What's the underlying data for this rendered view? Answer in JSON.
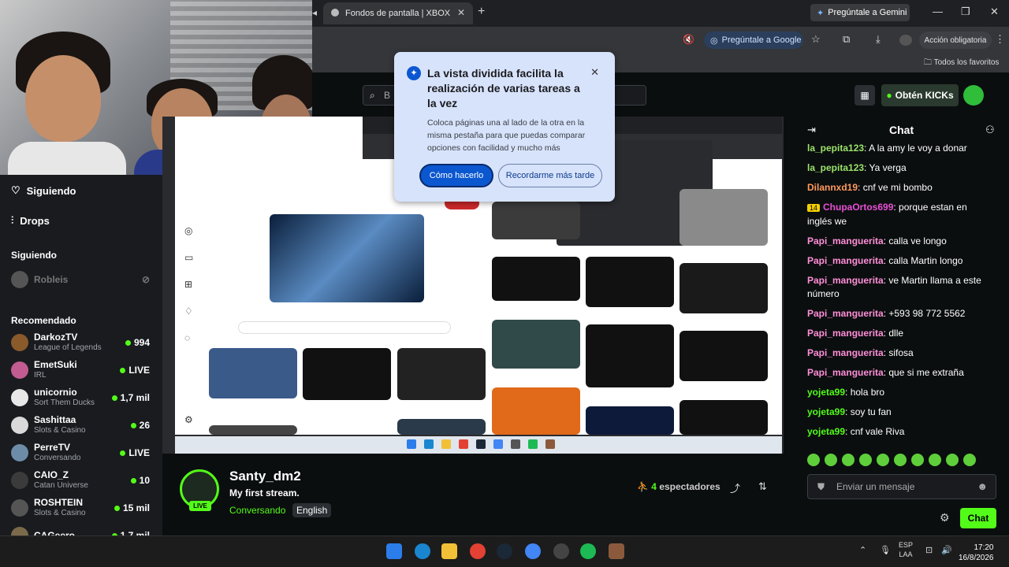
{
  "browser": {
    "tab_title": "Fondos de pantalla | XBOX",
    "gemini_button": "Pregúntale a Gemini",
    "ask_google": "Pregúntale a Google",
    "action_required": "Acción obligatoria",
    "favorites": "Todos los favoritos"
  },
  "kick": {
    "search_placeholder": "B",
    "kicks_button": "Obtén KICKs"
  },
  "popup": {
    "title": "La vista dividida facilita la realización de varias tareas a la vez",
    "body": "Coloca páginas una al lado de la otra en la misma pestaña para que puedas comparar opciones con facilidad y mucho más",
    "primary": "Cómo hacerlo",
    "secondary": "Recordarme más tarde"
  },
  "sidebar": {
    "following": "Siguiendo",
    "drops": "Drops",
    "following_header": "Siguiendo",
    "followed_channel": "Robleis",
    "recommended_header": "Recomendado",
    "channels": [
      {
        "name": "DarkozTV",
        "category": "League of Legends",
        "viewers": "994",
        "color": "#8a5a2b"
      },
      {
        "name": "EmetSuki",
        "category": "IRL",
        "viewers": "LIVE",
        "color": "#c25b8f"
      },
      {
        "name": "unicornio",
        "category": "Sort Them Ducks",
        "viewers": "1,7 mil",
        "color": "#e8e8e8"
      },
      {
        "name": "Sashittaa",
        "category": "Slots & Casino",
        "viewers": "26",
        "color": "#d9d9d9"
      },
      {
        "name": "PerreTV",
        "category": "Conversando",
        "viewers": "LIVE",
        "color": "#6d8ca8"
      },
      {
        "name": "CAIO_Z",
        "category": "Catan Universe",
        "viewers": "10",
        "color": "#3b3b3b"
      },
      {
        "name": "ROSHTEIN",
        "category": "Slots & Casino",
        "viewers": "15 mil",
        "color": "#555"
      },
      {
        "name": "CAGeero",
        "category": "",
        "viewers": "1,7 mil",
        "color": "#7b6a4a"
      }
    ]
  },
  "stream": {
    "streamer": "Santy_dm2",
    "title": "My first stream.",
    "category": "Conversando",
    "language": "English",
    "live_badge": "LIVE",
    "viewers_count": "4",
    "viewers_label": "espectadores"
  },
  "chat": {
    "title": "Chat",
    "messages": [
      {
        "user": "la_pepita123",
        "text": "A la amy le voy a donar",
        "color": "#9be36b"
      },
      {
        "user": "la_pepita123",
        "text": "Ya verga",
        "color": "#9be36b"
      },
      {
        "user": "Dilannxd19",
        "text": "cnf ve mi bombo",
        "color": "#ff9a5c"
      },
      {
        "user": "ChupaOrtos699",
        "text": "porque estan en inglés we",
        "color": "#e84fd6",
        "badge": "14"
      },
      {
        "user": "Papi_manguerita",
        "text": "calla ve longo",
        "color": "#ff8fd8"
      },
      {
        "user": "Papi_manguerita",
        "text": "calla Martin longo",
        "color": "#ff8fd8"
      },
      {
        "user": "Papi_manguerita",
        "text": "ve Martin llama a este número",
        "color": "#ff8fd8"
      },
      {
        "user": "Papi_manguerita",
        "text": "+593 98 772 5562",
        "color": "#ff8fd8"
      },
      {
        "user": "Papi_manguerita",
        "text": "dlle",
        "color": "#ff8fd8"
      },
      {
        "user": "Papi_manguerita",
        "text": "sifosa",
        "color": "#ff8fd8"
      },
      {
        "user": "Papi_manguerita",
        "text": "que si me extraña",
        "color": "#ff8fd8"
      },
      {
        "user": "yojeta99",
        "text": "hola bro",
        "color": "#53fc18"
      },
      {
        "user": "yojeta99",
        "text": "soy tu fan",
        "color": "#53fc18"
      },
      {
        "user": "yojeta99",
        "text": "cnf vale Riva",
        "color": "#53fc18"
      }
    ],
    "input_placeholder": "Enviar un mensaje",
    "send_button": "Chat"
  },
  "taskbar": {
    "lang": "ESP",
    "lang2": "LAA",
    "time": "17:20",
    "date": "16/8/2026"
  },
  "colors": {
    "kick_green": "#53fc18",
    "google_blue": "#0b57d0"
  }
}
